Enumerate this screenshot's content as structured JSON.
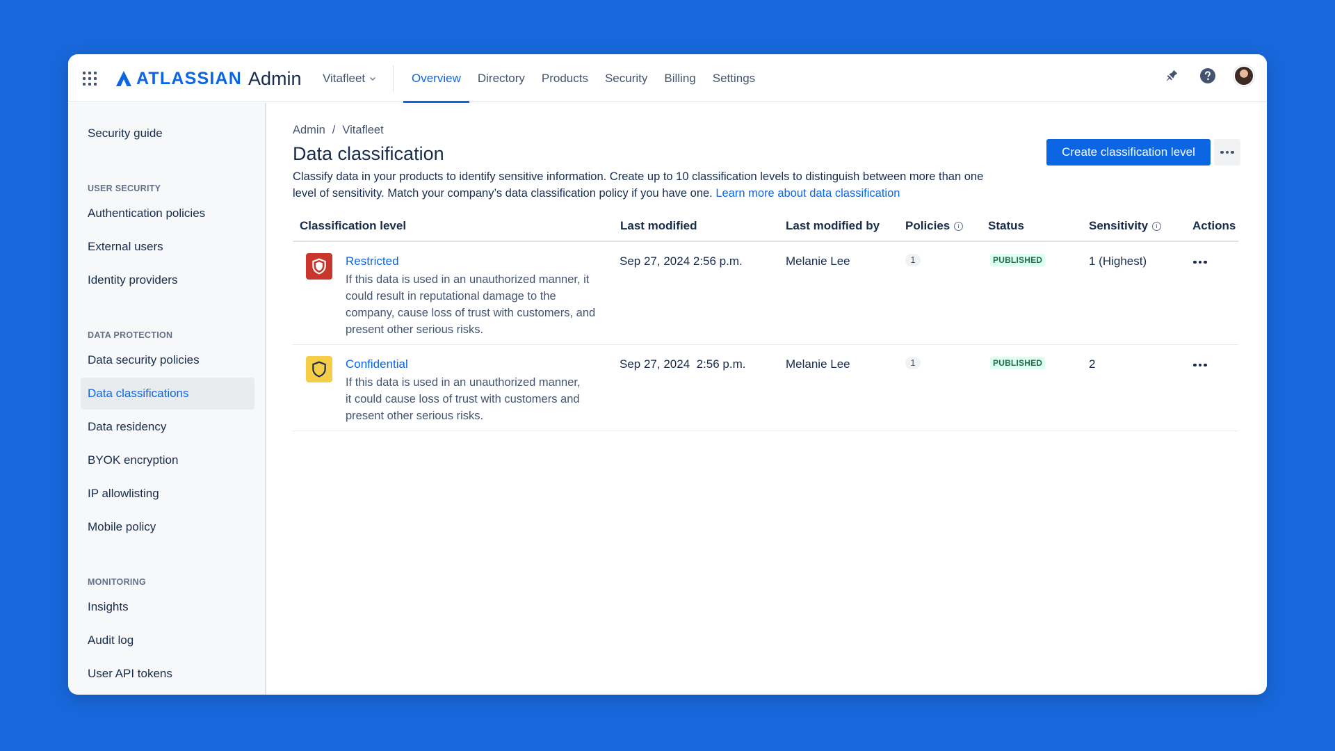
{
  "brand": {
    "logo_text": "ATLASSIAN",
    "product": "Admin",
    "accent_color": "#0C66E4",
    "background_color": "#1868DB"
  },
  "topnav": {
    "workspace": "Vitafleet",
    "tabs": [
      {
        "label": "Overview",
        "active": true
      },
      {
        "label": "Directory"
      },
      {
        "label": "Products"
      },
      {
        "label": "Security"
      },
      {
        "label": "Billing"
      },
      {
        "label": "Settings"
      }
    ],
    "icons": [
      "app-switcher-icon",
      "notification-icon",
      "help-icon",
      "avatar"
    ]
  },
  "sidebar": {
    "top_item": "Security guide",
    "sections": [
      {
        "heading": "USER SECURITY",
        "items": [
          "Authentication policies",
          "External users",
          "Identity providers"
        ]
      },
      {
        "heading": "DATA PROTECTION",
        "items": [
          "Data security policies",
          "Data classifications",
          "Data residency",
          "BYOK encryption",
          "IP allowlisting",
          "Mobile policy"
        ]
      },
      {
        "heading": "MONITORING",
        "items": [
          "Insights",
          "Audit log",
          "User API tokens"
        ]
      }
    ],
    "active_item": "Data classifications"
  },
  "main": {
    "breadcrumb": [
      "Admin",
      "Vitafleet"
    ],
    "breadcrumb_separator": "/",
    "title": "Data classification",
    "create_button": "Create classification level",
    "description": "Classify data in your products to identify sensitive information. Create up to 10 classification levels to distinguish between more than one level of sensitivity. Match your company’s data classification policy if you have one.",
    "learn_more": "Learn more about data classification",
    "table": {
      "headers": [
        "Classification level",
        "Last modified",
        "Last modified by",
        "Policies",
        "Status",
        "Sensitivity",
        "Actions"
      ],
      "rows": [
        {
          "name": "Restricted",
          "icon": "shield-icon",
          "icon_color": "#C9372C",
          "description": "If this data is used in an unauthorized manner, it could result in reputational damage to the company, cause loss of trust with customers, and present other serious risks.",
          "last_modified": "Sep 27, 2024 2:56 p.m.",
          "modified_by": "Melanie Lee",
          "policies": "1",
          "status": "PUBLISHED",
          "sensitivity": "1 (Highest)"
        },
        {
          "name": "Confidential",
          "icon": "shield-icon",
          "icon_color": "#F5CD47",
          "description": "If this data is used in an unauthorized manner, it could cause loss of trust with customers and present other serious risks.",
          "last_modified": "Sep 27, 2024  2:56 p.m.",
          "modified_by": "Melanie Lee",
          "policies": "1",
          "status": "PUBLISHED",
          "sensitivity": "2"
        }
      ]
    }
  }
}
